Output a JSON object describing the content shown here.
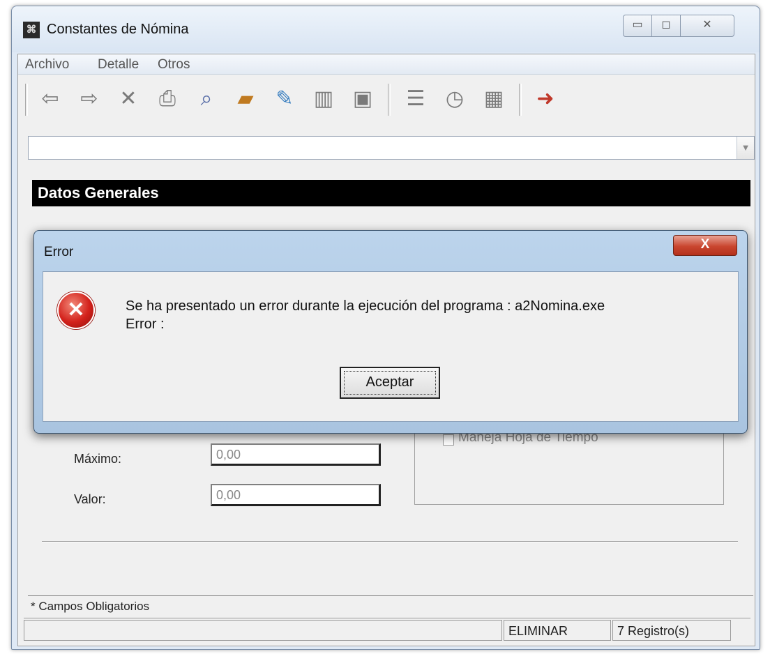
{
  "window": {
    "title": "Constantes de Nómina",
    "minimize_icon": "minimize-icon",
    "maximize_icon": "maximize-icon",
    "close_icon": "close-icon"
  },
  "menu": [
    "Archivo",
    "Detalle",
    "Otros"
  ],
  "toolbar": {
    "icons": [
      "back-arrow-icon",
      "forward-arrow-icon",
      "delete-x-icon",
      "print-icon",
      "search-icon",
      "open-folder-icon",
      "edit-icon",
      "trash-icon",
      "save-icon",
      "report-icon",
      "document-settings-icon",
      "calculator-icon",
      "exit-door-icon"
    ]
  },
  "combo": {
    "value": ""
  },
  "section": {
    "title": "Datos Generales"
  },
  "form": {
    "maximo_label": "Máximo:",
    "maximo_value": "0,00",
    "valor_label": "Valor:",
    "valor_value": "0,00",
    "checkbox_label": "Maneja Hoja de Tiempo"
  },
  "required_note": "* Campos Obligatorios",
  "status": {
    "mode": "ELIMINAR",
    "records": "7 Registro(s)"
  },
  "dialog": {
    "title": "Error",
    "close_symbol": "X",
    "message_line1": "Se ha presentado un error durante la ejecución del programa : a2Nomina.exe",
    "message_line2": "Error :",
    "button_label": "Aceptar",
    "icon": "error-icon"
  },
  "colors": {
    "title_bar": "#dfe9f5",
    "section_header": "#000000",
    "dialog_frame": "#a9c4e0",
    "error_red": "#d3211b"
  }
}
